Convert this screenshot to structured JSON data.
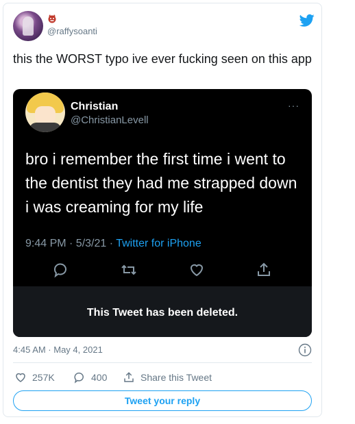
{
  "tweet": {
    "handle": "@raffysoanti",
    "text": "this the WORST typo ive ever fucking seen on this app",
    "timestamp": "4:45 AM · May 4, 2021",
    "likes": "257K",
    "replies": "400",
    "share_label": "Share this Tweet",
    "reply_button_label": "Tweet your reply"
  },
  "quoted": {
    "name": "Christian",
    "handle": "@ChristianLevell",
    "more": "···",
    "text": "bro i remember the first time i went to the dentist they had me strapped down i was creaming for my life",
    "time": "9:44 PM · 5/3/21 · ",
    "source": "Twitter for iPhone",
    "deleted_notice": "This Tweet has been deleted."
  },
  "colors": {
    "accent": "#1da1f2",
    "quote_bg": "#000000",
    "deleted_bg": "#15181c"
  },
  "icons": [
    "twitter-bird-icon",
    "reply-icon",
    "retweet-icon",
    "like-icon",
    "share-icon",
    "info-icon"
  ]
}
